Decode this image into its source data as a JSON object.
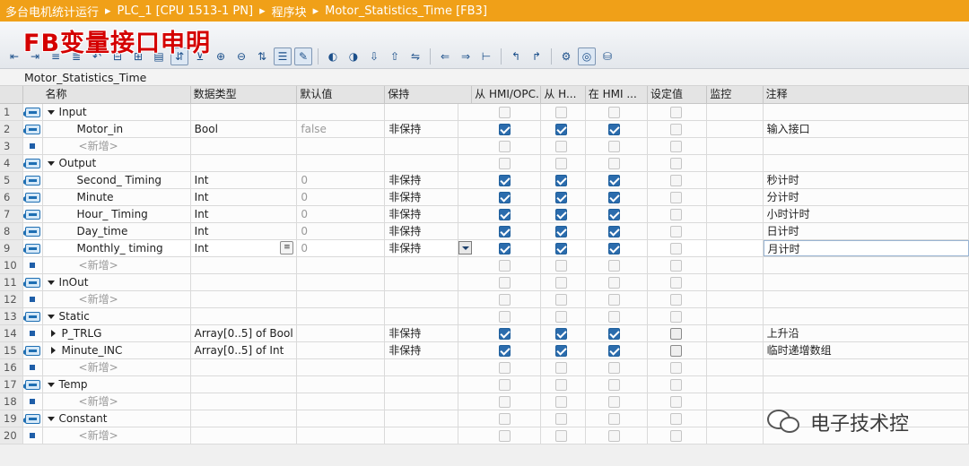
{
  "breadcrumb": [
    "多台电机统计运行",
    "PLC_1 [CPU 1513-1 PN]",
    "程序块",
    "Motor_Statistics_Time [FB3]"
  ],
  "overlay_title": "FB变量接口申明",
  "block_name": "Motor_Statistics_Time",
  "columns": {
    "name": "名称",
    "type": "数据类型",
    "default": "默认值",
    "retain": "保持",
    "hmi_opc": "从 HMI/OPC...",
    "hmi_h": "从 H...",
    "in_hmi": "在 HMI ...",
    "setpoint": "设定值",
    "monitor": "监控",
    "comment": "注释"
  },
  "rows": [
    {
      "num": "1",
      "icon": "interface",
      "kind": "section",
      "name": "Input",
      "type": "",
      "default": "",
      "retain": "",
      "hmi": [
        false,
        false,
        false
      ],
      "set": false,
      "comment": ""
    },
    {
      "num": "2",
      "icon": "interface",
      "kind": "var",
      "name": "Motor_in",
      "type": "Bool",
      "default": "false",
      "retain": "非保持",
      "hmi": [
        true,
        true,
        true
      ],
      "set": false,
      "comment": "输入接口"
    },
    {
      "num": "3",
      "icon": "bullet",
      "kind": "add",
      "name": "<新增>",
      "type": "",
      "default": "",
      "retain": "",
      "hmi": [
        false,
        false,
        false
      ],
      "set": false,
      "comment": ""
    },
    {
      "num": "4",
      "icon": "interface",
      "kind": "section",
      "name": "Output",
      "type": "",
      "default": "",
      "retain": "",
      "hmi": [
        false,
        false,
        false
      ],
      "set": false,
      "comment": ""
    },
    {
      "num": "5",
      "icon": "interface",
      "kind": "var",
      "name": "Second_ Timing",
      "type": "Int",
      "default": "0",
      "retain": "非保持",
      "hmi": [
        true,
        true,
        true
      ],
      "set": false,
      "comment": "秒计时"
    },
    {
      "num": "6",
      "icon": "interface",
      "kind": "var",
      "name": "Minute",
      "type": "Int",
      "default": "0",
      "retain": "非保持",
      "hmi": [
        true,
        true,
        true
      ],
      "set": false,
      "comment": "分计时"
    },
    {
      "num": "7",
      "icon": "interface",
      "kind": "var",
      "name": "Hour_ Timing",
      "type": "Int",
      "default": "0",
      "retain": "非保持",
      "hmi": [
        true,
        true,
        true
      ],
      "set": false,
      "comment": "小时计时"
    },
    {
      "num": "8",
      "icon": "interface",
      "kind": "var",
      "name": "Day_time",
      "type": "Int",
      "default": "0",
      "retain": "非保持",
      "hmi": [
        true,
        true,
        true
      ],
      "set": false,
      "comment": "日计时"
    },
    {
      "num": "9",
      "icon": "interface",
      "kind": "var",
      "name": "Monthly_ timing",
      "type": "Int",
      "default": "0",
      "retain": "非保持",
      "hmi": [
        true,
        true,
        true
      ],
      "set": false,
      "comment": "月计时",
      "selected": true
    },
    {
      "num": "10",
      "icon": "bullet",
      "kind": "add",
      "name": "<新增>",
      "type": "",
      "default": "",
      "retain": "",
      "hmi": [
        false,
        false,
        false
      ],
      "set": false,
      "comment": ""
    },
    {
      "num": "11",
      "icon": "interface",
      "kind": "section",
      "name": "InOut",
      "type": "",
      "default": "",
      "retain": "",
      "hmi": [
        false,
        false,
        false
      ],
      "set": false,
      "comment": ""
    },
    {
      "num": "12",
      "icon": "bullet",
      "kind": "add",
      "name": "<新增>",
      "type": "",
      "default": "",
      "retain": "",
      "hmi": [
        false,
        false,
        false
      ],
      "set": false,
      "comment": ""
    },
    {
      "num": "13",
      "icon": "interface",
      "kind": "section",
      "name": "Static",
      "type": "",
      "default": "",
      "retain": "",
      "hmi": [
        false,
        false,
        false
      ],
      "set": false,
      "comment": ""
    },
    {
      "num": "14",
      "icon": "bullet",
      "kind": "array",
      "name": "P_TRLG",
      "type": "Array[0..5] of Bool",
      "default": "",
      "retain": "非保持",
      "hmi": [
        true,
        true,
        true
      ],
      "set": false,
      "setDark": true,
      "comment": "上升沿"
    },
    {
      "num": "15",
      "icon": "interface",
      "kind": "array",
      "name": "Minute_INC",
      "type": "Array[0..5] of Int",
      "default": "",
      "retain": "非保持",
      "hmi": [
        true,
        true,
        true
      ],
      "set": false,
      "setDark": true,
      "comment": "临时递增数组"
    },
    {
      "num": "16",
      "icon": "bullet",
      "kind": "add",
      "name": "<新增>",
      "type": "",
      "default": "",
      "retain": "",
      "hmi": [
        false,
        false,
        false
      ],
      "set": false,
      "comment": ""
    },
    {
      "num": "17",
      "icon": "interface",
      "kind": "section",
      "name": "Temp",
      "type": "",
      "default": "",
      "retain": "",
      "hmi": [
        false,
        false,
        false
      ],
      "set": false,
      "comment": ""
    },
    {
      "num": "18",
      "icon": "bullet",
      "kind": "add",
      "name": "<新增>",
      "type": "",
      "default": "",
      "retain": "",
      "hmi": [
        false,
        false,
        false
      ],
      "set": false,
      "comment": ""
    },
    {
      "num": "19",
      "icon": "interface",
      "kind": "section",
      "name": "Constant",
      "type": "",
      "default": "",
      "retain": "",
      "hmi": [
        false,
        false,
        false
      ],
      "set": false,
      "comment": ""
    },
    {
      "num": "20",
      "icon": "bullet",
      "kind": "add",
      "name": "<新增>",
      "type": "",
      "default": "",
      "retain": "",
      "hmi": [
        false,
        false,
        false
      ],
      "set": false,
      "comment": ""
    }
  ],
  "watermark": "电子技术控",
  "colors": {
    "breadcrumb_bg": "#f0a018",
    "title_red": "#d40000",
    "check_blue": "#2b6cad"
  }
}
